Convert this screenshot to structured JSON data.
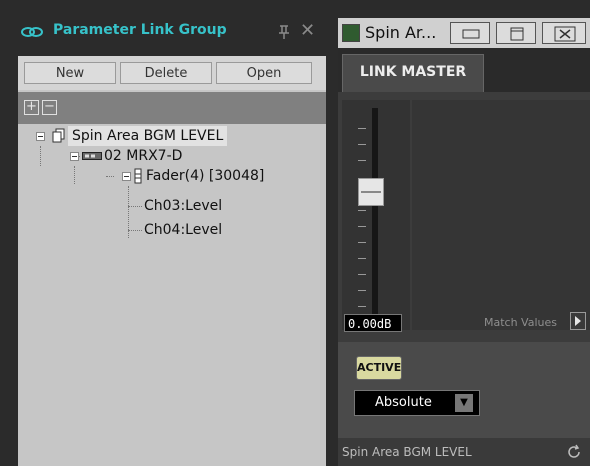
{
  "left_panel": {
    "title": "Parameter Link Group",
    "buttons": {
      "new": "New",
      "delete": "Delete",
      "open": "Open"
    },
    "tree": {
      "root": "Spin Area BGM LEVEL",
      "device": "02 MRX7-D",
      "component": "Fader(4) [30048]",
      "params": [
        "Ch03:Level",
        "Ch04:Level"
      ]
    }
  },
  "right_panel": {
    "window_title": "Spin Ar...",
    "tab": "LINK MASTER",
    "fader_value": "0.00dB",
    "match_values": "Match Values",
    "active_label": "ACTIVE",
    "mode_value": "Absolute",
    "status": "Spin Area BGM LEVEL"
  },
  "colors": {
    "accent": "#37c2c9",
    "active": "#d9d9a0"
  }
}
